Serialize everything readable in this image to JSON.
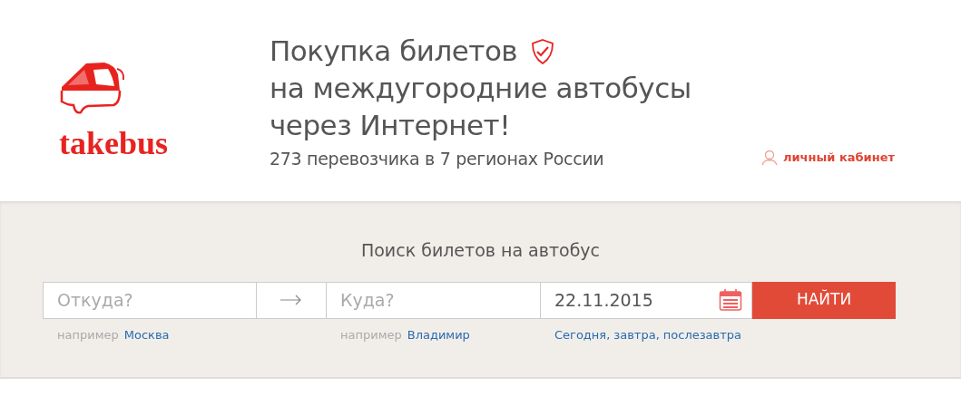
{
  "header": {
    "logo_text": "takebus",
    "title_lines": [
      "Покупка билетов",
      "на междугородние автобусы",
      "через Интернет!"
    ],
    "subtitle": "273 перевозчика в 7 регионах России",
    "account_link": "личный кабинет"
  },
  "search": {
    "title": "Поиск билетов на автобус",
    "from": {
      "placeholder": "Откуда?",
      "hint_label": "например",
      "hint_example": "Москва"
    },
    "to": {
      "placeholder": "Куда?",
      "hint_label": "например",
      "hint_example": "Владимир"
    },
    "date": {
      "value": "22.11.2015",
      "separator": ",",
      "quick_dates": [
        "Сегодня",
        "завтра",
        "послезавтра"
      ]
    },
    "button": "НАЙТИ"
  }
}
